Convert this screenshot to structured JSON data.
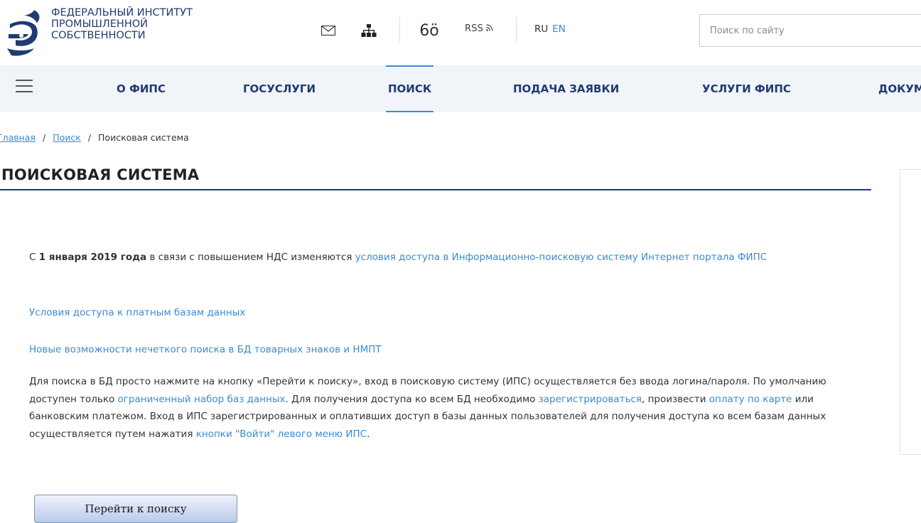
{
  "header": {
    "org_name_lines": [
      "ФЕДЕРАЛЬНЫЙ ИНСТИТУТ",
      "ПРОМЫШЛЕННОЙ",
      "СОБСТВЕННОСТИ"
    ],
    "icons": [
      "mail-icon",
      "sitemap-icon",
      "glasses-icon"
    ],
    "glasses_glyph": "6ö",
    "rss_label": "RSS",
    "rss_glyph": "))",
    "lang_ru": "RU",
    "lang_en": "EN",
    "search_placeholder": "Поиск по сайту"
  },
  "nav": {
    "items": [
      "О ФИПС",
      "ГОСУСЛУГИ",
      "ПОИСК",
      "ПОДАЧА ЗАЯВКИ",
      "УСЛУГИ ФИПС",
      "ДОКУМ"
    ],
    "active": "ПОИСК"
  },
  "breadcrumb": {
    "items": [
      "Главная",
      "Поиск",
      "Поисковая система"
    ],
    "sep": "/"
  },
  "page_title": "ПОИСКОВАЯ СИСТЕМА",
  "content": {
    "p1_prefix": "С ",
    "p1_bold": "1 января 2019 года",
    "p1_mid": " в связи с повышением НДС изменяются ",
    "p1_link": "условия доступа в Информационно-поисковую систему Интернет портала ФИПС",
    "p2_link": "Условия доступа к платным базам данных",
    "p3_link": "Новые возможности нечеткого поиска в БД товарных знаков и НМПТ",
    "p4_t1": "Для поиска в БД просто нажмите на кнопку «Перейти к поиску», вход в поисковую систему (ИПС) осуществляется без ввода логина/пароля. По умолчанию доступен только ",
    "p4_l1": "ограниченный набор баз данных",
    "p4_t2": ". Для получения доступа ко всем БД необходимо ",
    "p4_l2": "зарегистрироваться",
    "p4_t3": ", произвести ",
    "p4_l3": "оплату по карте",
    "p4_t4": " или банковским платежом. Вход в ИПС зарегистрированных и оплативших доступ в базы данных пользователей для получения доступа ко всем базам данных осуществляется путем нажатия ",
    "p4_l4": "кнопки \"Войти\" левого меню ИПС",
    "p4_t5": "."
  },
  "button_label": "Перейти к поиску",
  "colors": {
    "brand": "#1f3b73",
    "link": "#3a8ad6",
    "nav_bg": "#f1f4f8"
  }
}
